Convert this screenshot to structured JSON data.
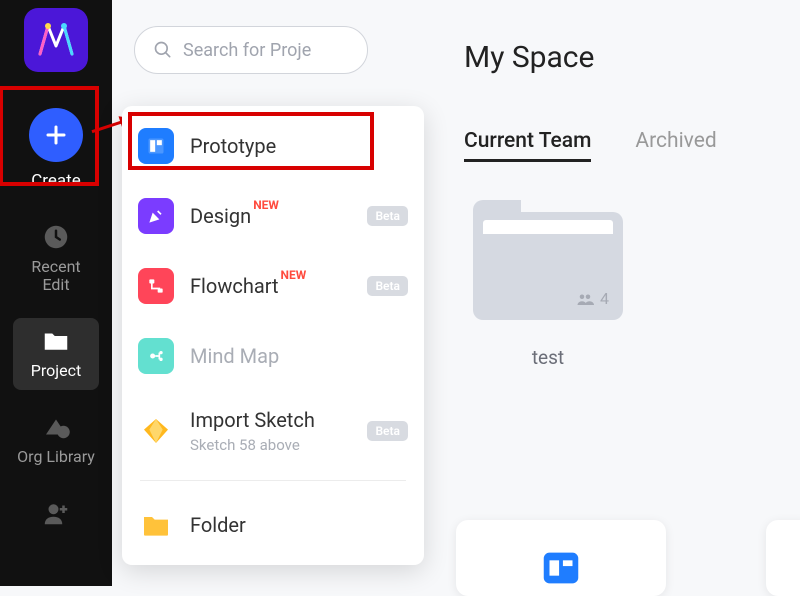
{
  "rail": {
    "create_label": "Create",
    "items": [
      {
        "id": "recent",
        "label": "Recent\nEdit"
      },
      {
        "id": "project",
        "label": "Project"
      },
      {
        "id": "org",
        "label": "Org Library"
      },
      {
        "id": "members",
        "label": ""
      }
    ]
  },
  "search": {
    "placeholder": "Search for Proje"
  },
  "create_menu": {
    "items": [
      {
        "id": "prototype",
        "label": "Prototype",
        "icon_color": "#1f7dff"
      },
      {
        "id": "design",
        "label": "Design",
        "new": "NEW",
        "beta": "Beta",
        "icon_color": "#7b3cff"
      },
      {
        "id": "flowchart",
        "label": "Flowchart",
        "new": "NEW",
        "beta": "Beta",
        "icon_color": "#ff4559"
      },
      {
        "id": "mindmap",
        "label": "Mind Map",
        "muted": true,
        "icon_color": "#63e0d0"
      },
      {
        "id": "sketch",
        "label": "Import Sketch",
        "beta": "Beta",
        "sub": "Sketch 58 above",
        "icon_color": "#ffb81e"
      },
      {
        "id": "folder",
        "label": "Folder",
        "icon_color": "#ffc23a"
      }
    ]
  },
  "space": {
    "title": "My Space",
    "tabs": [
      {
        "id": "current",
        "label": "Current Team",
        "active": true
      },
      {
        "id": "archived",
        "label": "Archived"
      }
    ],
    "teams": [
      {
        "id": "test",
        "name": "test",
        "members": "4"
      }
    ]
  }
}
